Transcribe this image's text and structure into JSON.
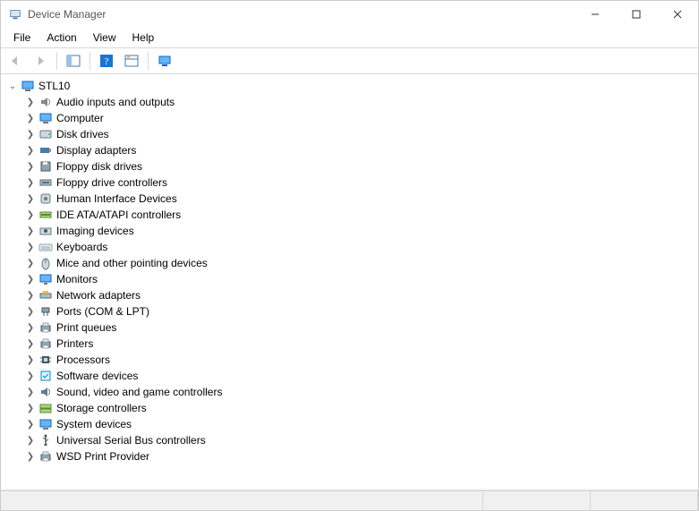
{
  "window": {
    "title": "Device Manager"
  },
  "menu": {
    "items": [
      "File",
      "Action",
      "View",
      "Help"
    ]
  },
  "toolbar": {
    "back": "back-icon",
    "forward": "forward-icon",
    "show_hide": "show-hide-tree-icon",
    "help": "help-icon",
    "properties": "properties-icon",
    "scan": "scan-hardware-icon"
  },
  "tree": {
    "root": {
      "label": "STL10",
      "expanded": true,
      "icon": "computer-icon"
    },
    "children": [
      {
        "label": "Audio inputs and outputs",
        "icon": "audio-icon"
      },
      {
        "label": "Computer",
        "icon": "computer-icon"
      },
      {
        "label": "Disk drives",
        "icon": "disk-icon"
      },
      {
        "label": "Display adapters",
        "icon": "display-adapter-icon"
      },
      {
        "label": "Floppy disk drives",
        "icon": "floppy-icon"
      },
      {
        "label": "Floppy drive controllers",
        "icon": "floppy-controller-icon"
      },
      {
        "label": "Human Interface Devices",
        "icon": "hid-icon"
      },
      {
        "label": "IDE ATA/ATAPI controllers",
        "icon": "ide-icon"
      },
      {
        "label": "Imaging devices",
        "icon": "imaging-icon"
      },
      {
        "label": "Keyboards",
        "icon": "keyboard-icon"
      },
      {
        "label": "Mice and other pointing devices",
        "icon": "mouse-icon"
      },
      {
        "label": "Monitors",
        "icon": "monitor-icon"
      },
      {
        "label": "Network adapters",
        "icon": "network-icon"
      },
      {
        "label": "Ports (COM & LPT)",
        "icon": "port-icon"
      },
      {
        "label": "Print queues",
        "icon": "print-queue-icon"
      },
      {
        "label": "Printers",
        "icon": "printer-icon"
      },
      {
        "label": "Processors",
        "icon": "processor-icon"
      },
      {
        "label": "Software devices",
        "icon": "software-icon"
      },
      {
        "label": "Sound, video and game controllers",
        "icon": "sound-icon"
      },
      {
        "label": "Storage controllers",
        "icon": "storage-icon"
      },
      {
        "label": "System devices",
        "icon": "system-icon"
      },
      {
        "label": "Universal Serial Bus controllers",
        "icon": "usb-icon"
      },
      {
        "label": "WSD Print Provider",
        "icon": "wsd-print-icon"
      }
    ]
  }
}
